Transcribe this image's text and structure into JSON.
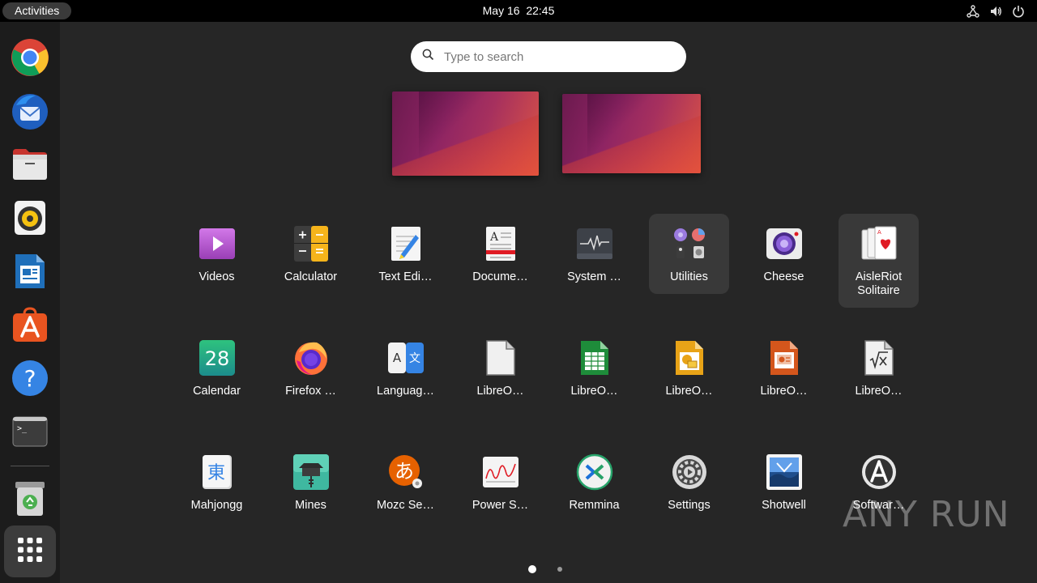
{
  "topbar": {
    "activities_label": "Activities",
    "date": "May 16",
    "time": "22:45",
    "tray_icons": [
      "network-icon",
      "volume-icon",
      "power-icon"
    ]
  },
  "dock": {
    "items": [
      {
        "name": "chrome",
        "icon": "chrome-icon"
      },
      {
        "name": "thunderbird",
        "icon": "thunderbird-icon"
      },
      {
        "name": "files",
        "icon": "files-icon"
      },
      {
        "name": "rhythmbox",
        "icon": "rhythmbox-icon"
      },
      {
        "name": "libreoffice-writer",
        "icon": "writer-icon"
      },
      {
        "name": "app-center",
        "icon": "app-center-icon"
      },
      {
        "name": "help",
        "icon": "help-icon"
      },
      {
        "name": "terminal",
        "icon": "terminal-icon"
      },
      {
        "name": "trash",
        "icon": "trash-icon"
      },
      {
        "name": "show-apps",
        "icon": "app-grid-icon"
      }
    ]
  },
  "search": {
    "placeholder": "Type to search"
  },
  "workspaces": [
    1,
    2
  ],
  "apps": {
    "row1": [
      {
        "label": "Videos",
        "icon": "videos-icon"
      },
      {
        "label": "Calculator",
        "icon": "calculator-icon"
      },
      {
        "label": "Text Edi…",
        "icon": "text-editor-icon"
      },
      {
        "label": "Docume…",
        "icon": "document-viewer-icon"
      },
      {
        "label": "System …",
        "icon": "system-monitor-icon"
      },
      {
        "label": "Utilities",
        "icon": "utilities-folder-icon"
      },
      {
        "label": "Cheese",
        "icon": "cheese-icon"
      },
      {
        "label": "AisleRiot Solitaire",
        "icon": "solitaire-icon"
      }
    ],
    "row2": [
      {
        "label": "Calendar",
        "icon": "calendar-icon",
        "day": "28"
      },
      {
        "label": "Firefox …",
        "icon": "firefox-icon"
      },
      {
        "label": "Languag…",
        "icon": "language-icon"
      },
      {
        "label": "LibreO…",
        "icon": "libreoffice-icon"
      },
      {
        "label": "LibreO…",
        "icon": "libreoffice-calc-icon"
      },
      {
        "label": "LibreO…",
        "icon": "libreoffice-draw-icon"
      },
      {
        "label": "LibreO…",
        "icon": "libreoffice-impress-icon"
      },
      {
        "label": "LibreO…",
        "icon": "libreoffice-math-icon"
      }
    ],
    "row3": [
      {
        "label": "Mahjongg",
        "icon": "mahjongg-icon",
        "glyph": "東"
      },
      {
        "label": "Mines",
        "icon": "mines-icon"
      },
      {
        "label": "Mozc Se…",
        "icon": "mozc-icon",
        "glyph": "あ"
      },
      {
        "label": "Power S…",
        "icon": "power-statistics-icon"
      },
      {
        "label": "Remmina",
        "icon": "remmina-icon"
      },
      {
        "label": "Settings",
        "icon": "settings-icon"
      },
      {
        "label": "Shotwell",
        "icon": "shotwell-icon"
      },
      {
        "label": "Softwar…",
        "icon": "software-updater-icon"
      }
    ]
  },
  "pagination": {
    "pages": 2,
    "current": 1
  },
  "watermark": "ANY RUN",
  "colors": {
    "accent": "#e95420",
    "overview_bg": "#262626",
    "dock_bg": "#1c1c1c"
  }
}
